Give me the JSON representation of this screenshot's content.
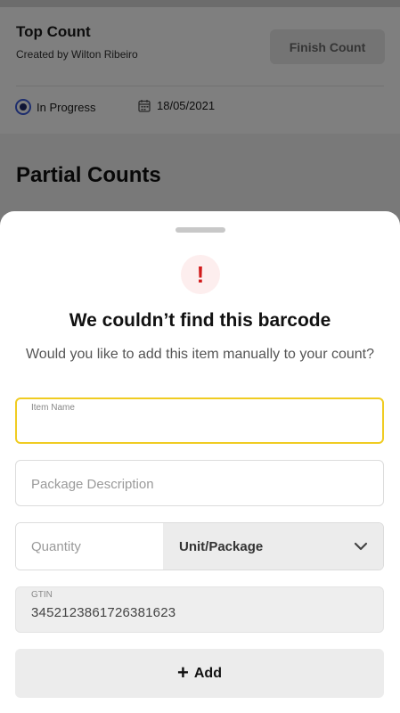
{
  "background": {
    "title": "Top Count",
    "subtitle": "Created by Wilton Ribeiro",
    "finish_button": "Finish Count",
    "status": "In Progress",
    "date": "18/05/2021",
    "section_title": "Partial Counts",
    "icons": {
      "status": "radio-selected-icon",
      "date": "calendar-icon"
    }
  },
  "sheet": {
    "alert_icon": "!",
    "title": "We couldn’t find this barcode",
    "description": "Would you like to add this item manually to your count?",
    "fields": {
      "item_name": {
        "label": "Item Name",
        "value": ""
      },
      "package_description": {
        "placeholder": "Package Description",
        "value": ""
      },
      "quantity": {
        "placeholder": "Quantity",
        "value": ""
      },
      "unit": {
        "selected": "Unit/Package"
      },
      "gtin": {
        "label": "GTIN",
        "value": "3452123861726381623"
      }
    },
    "add_button": {
      "icon": "+",
      "label": "Add"
    }
  },
  "colors": {
    "focus_border": "#f0cc22",
    "alert_red": "#d11a1a",
    "alert_bg": "#fdeeee",
    "status_blue": "#3b5bdb"
  }
}
